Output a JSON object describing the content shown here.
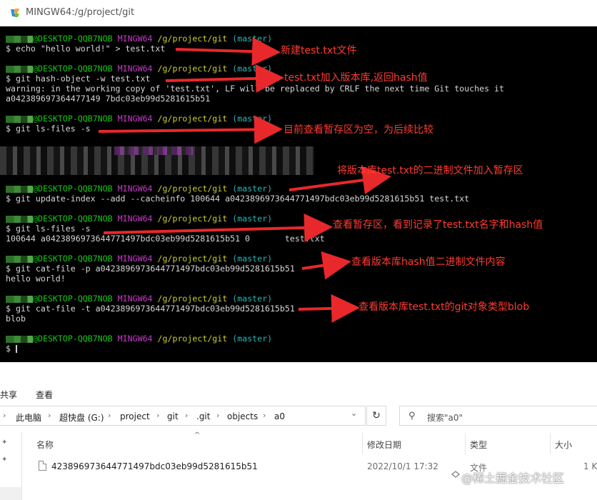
{
  "window": {
    "title": "MINGW64:/g/project/git"
  },
  "prompt": {
    "host": "@DESKTOP-QQB7NOB",
    "mingw": "MINGW64",
    "path": "/g/project/git",
    "branch": "(master)"
  },
  "terminal": {
    "cmd1": "$ echo \"hello world!\" > test.txt",
    "cmd2": "$ git hash-object -w test.txt",
    "out2a": "warning: in the working copy of 'test.txt', LF will be replaced by CRLF the next time Git touches it",
    "out2b": "a042389697364477149 7bdc03eb99d5281615b51",
    "cmd3": "$ git ls-files -s",
    "cmd4": "$ git update-index --add --cacheinfo 100644 a0423896973644771497bdc03eb99d5281615b51 test.txt",
    "cmd5": "$ git ls-files -s",
    "out5": "100644 a0423896973644771497bdc03eb99d5281615b51 0       test.txt",
    "cmd6": "$ git cat-file -p a0423896973644771497bdc03eb99d5281615b51",
    "out6": "hello world!",
    "cmd7": "$ git cat-file -t a0423896973644771497bdc03eb99d5281615b51",
    "out7": "blob",
    "cmd8": "$ "
  },
  "annotations": {
    "n1": "新建test.txt文件",
    "n2": "test.txt加入版本库,返回hash值",
    "n3": "目前查看暂存区为空，为后续比较",
    "n4": "将版本库test.txt的二进制文件加入暂存区",
    "n5": "查看暂存区，看到记录了test.txt名字和hash值",
    "n6": "查看版本库hash值二进制文件内容",
    "n7": "查看版本库test.txt的git对象类型blob"
  },
  "explorer": {
    "ribbon": {
      "share": "共享",
      "view": "查看"
    },
    "breadcrumb": [
      "此电脑",
      "超快盘 (G:)",
      "project",
      "git",
      ".git",
      "objects",
      "a0"
    ],
    "search_placeholder": "搜索\"a0\"",
    "columns": {
      "name": "名称",
      "modified": "修改日期",
      "type": "类型",
      "size": "大小"
    },
    "files": [
      {
        "name": "423896973644771497bdc03eb99d5281615b51",
        "modified": "2022/10/1 17:32",
        "type": "文件",
        "size": "1 K"
      }
    ],
    "watermark": "@稀土掘金技术社区"
  },
  "colors": {
    "annotation": "#ff3b30",
    "host": "#19c519",
    "mingw": "#c73ac7",
    "path": "#cdcd2a",
    "branch": "#2ab6b6"
  }
}
